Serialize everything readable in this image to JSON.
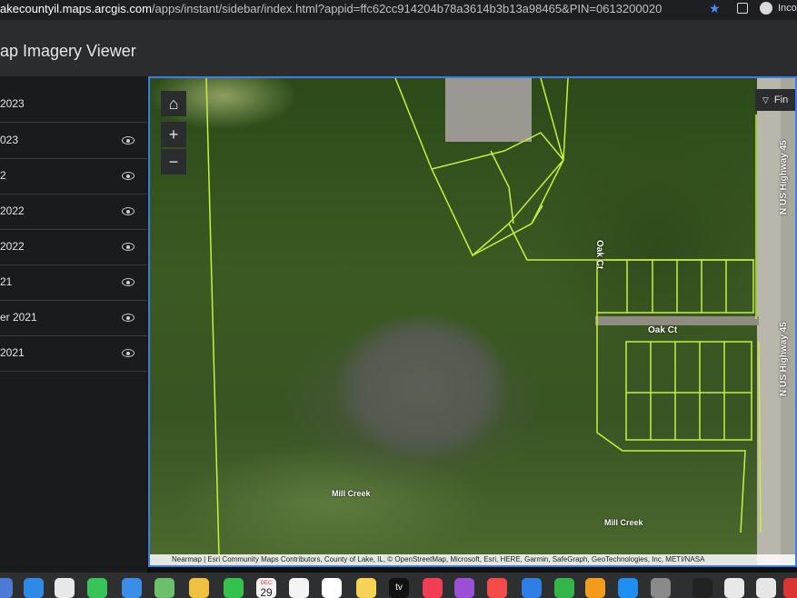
{
  "browser": {
    "url_host": "akecountyil.maps.arcgis.com",
    "url_path": "/apps/instant/sidebar/index.html?appid=ffc62cc914204b78a3614b3b13a98465&PIN=0613200020",
    "profile_label": "Inco"
  },
  "app": {
    "title": "ap Imagery Viewer"
  },
  "sidebar": {
    "items": [
      {
        "label": "2023"
      },
      {
        "label": "023"
      },
      {
        "label": "2"
      },
      {
        "label": " 2022"
      },
      {
        "label": "2022"
      },
      {
        "label": "21"
      },
      {
        "label": "er 2021"
      },
      {
        "label": " 2021"
      }
    ]
  },
  "map": {
    "search_placeholder": "Fin",
    "zoom_in": "+",
    "zoom_out": "−",
    "labels": {
      "oak_ct_vertical": "Oak Ct",
      "oak_ct": "Oak Ct",
      "highway_upper": "N US Highway 45",
      "highway_lower": "N US Highway 45",
      "mill_creek_1": "Mill Creek",
      "mill_creek_2": "Mill Creek"
    },
    "attribution": "Nearmap | Esri Community Maps Contributors, County of Lake, IL, © OpenStreetMap, Microsoft, Esri, HERE, Garmin, SafeGraph, GeoTechnologies, Inc, METI/NASA",
    "colors": {
      "parcel_line": "#c8f040",
      "map_border": "#3b7fe0"
    }
  },
  "dock": {
    "calendar_month": "DEC",
    "calendar_day": "29",
    "tv_label": "tv"
  }
}
